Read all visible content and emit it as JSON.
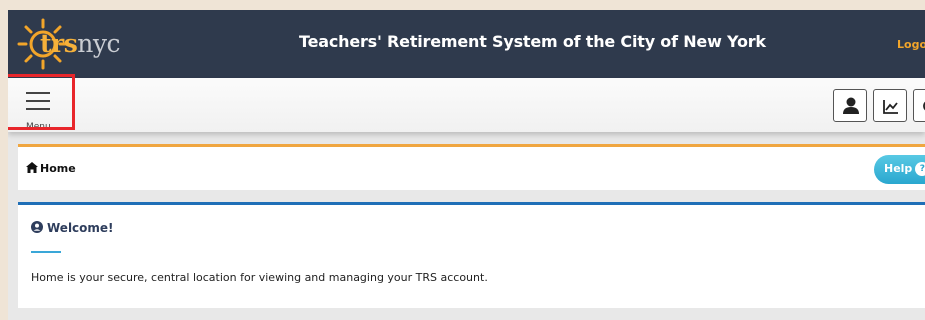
{
  "header": {
    "logo": {
      "prefix": "trs",
      "suffix": "nyc"
    },
    "title": "Teachers' Retirement System of the City of New York",
    "logout_label": "Logo"
  },
  "toolbar": {
    "menu_label": "Menu",
    "buttons": [
      "user-icon",
      "chart-icon",
      "more-icon"
    ]
  },
  "breadcrumb": {
    "home_label": "Home",
    "help_label": "Help"
  },
  "welcome": {
    "title": "Welcome!",
    "text": "Home is your secure, central location for viewing and managing your TRS account."
  },
  "colors": {
    "header_bg": "#2f3a4d",
    "accent_orange": "#f2a52a",
    "accent_blue": "#1f6fb7",
    "highlight_red": "#e8262b"
  }
}
